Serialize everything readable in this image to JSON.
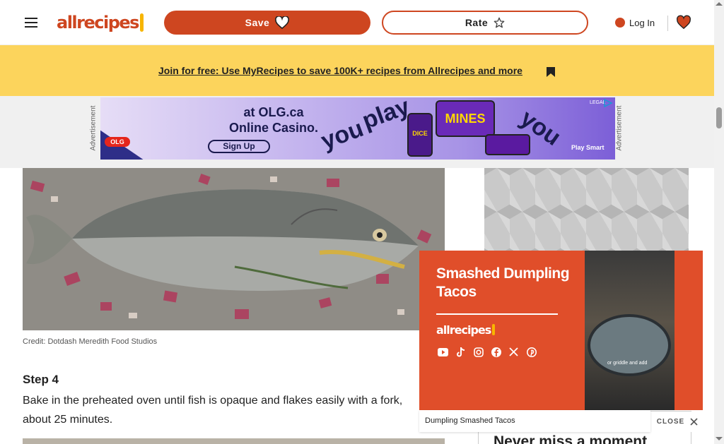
{
  "header": {
    "logo_text": "allrecipes",
    "save_label": "Save",
    "rate_label": "Rate",
    "login_label": "Log In"
  },
  "banner": {
    "link_text": "Join for free: Use MyRecipes to save 100K+ recipes from Allrecipes and more"
  },
  "top_ad": {
    "side_label": "Advertisement",
    "headline_line1": "at OLG.ca",
    "headline_line2": "Online Casino.",
    "button_label": "Sign Up",
    "brand_badge": "OLG",
    "slogan_word1": "you",
    "slogan_word2": "play",
    "slogan_word3": "you",
    "game_name": "MINES",
    "game_name2": "DICE",
    "footer": "Play Smart",
    "legal": "LEGAL",
    "colors": {
      "brand_navy": "#1a1a4e",
      "brand_red": "#e5261c"
    }
  },
  "content": {
    "photo_credit": "Credit: Dotdash Meredith Food Studios",
    "step_heading": "Step 4",
    "step_text": "Bake in the preheated oven until fish is opaque and flakes easily with a fork, about 25 minutes."
  },
  "sidebar": {
    "newsletter_heading": "Never miss a moment"
  },
  "video": {
    "title": "Smashed Dumpling Tacos",
    "brand": "allrecipes",
    "in_video_caption": "or griddle and add",
    "caption": "Dumpling Smashed Tacos",
    "close_label": "CLOSE",
    "socials": [
      "youtube-icon",
      "tiktok-icon",
      "instagram-icon",
      "facebook-icon",
      "x-icon",
      "pinterest-icon"
    ],
    "colors": {
      "background": "#e04e2a"
    }
  },
  "colors": {
    "accent": "#ce4620",
    "banner": "#fcd45c",
    "logo_spoon": "#f7b500"
  }
}
